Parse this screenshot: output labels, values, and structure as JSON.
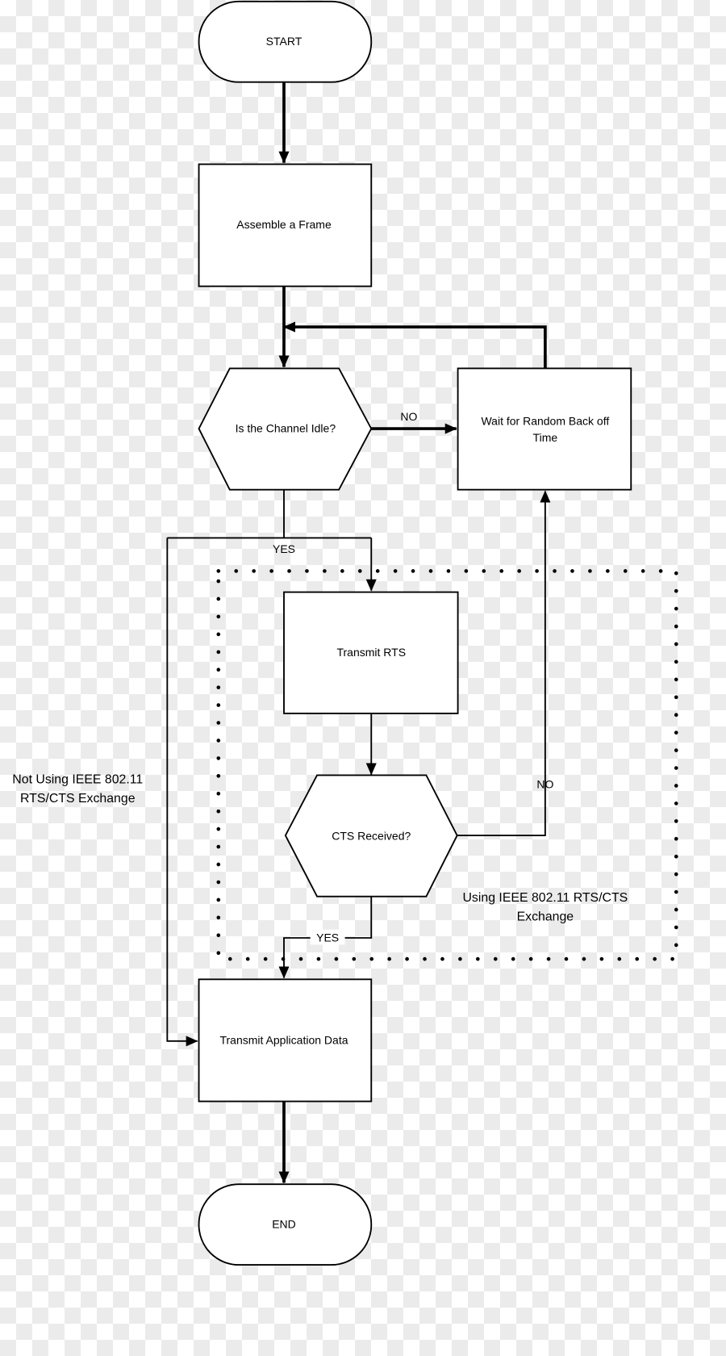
{
  "nodes": {
    "start": "START",
    "assemble": "Assemble a Frame",
    "channel_idle": "Is the Channel Idle?",
    "wait_line1": "Wait for Random Back off",
    "wait_line2": "Time",
    "transmit_rts": "Transmit RTS",
    "cts_received": "CTS Received?",
    "transmit_data": "Transmit Application Data",
    "end": "END"
  },
  "edges": {
    "idle_no": "NO",
    "idle_yes": "YES",
    "cts_no": "NO",
    "cts_yes": "YES"
  },
  "annotations": {
    "not_using_line1": "Not Using IEEE 802.11",
    "not_using_line2": "RTS/CTS Exchange",
    "using_line1": "Using IEEE 802.11 RTS/CTS",
    "using_line2": "Exchange"
  }
}
